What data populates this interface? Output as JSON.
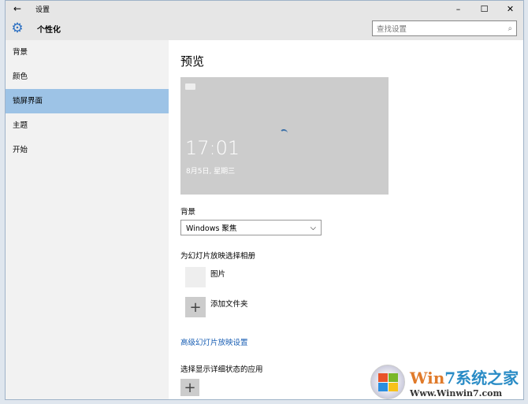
{
  "titlebar": {
    "title": "设置",
    "back": "←",
    "minimize": "–",
    "maximize": "☐",
    "close": "✕"
  },
  "header": {
    "title": "个性化",
    "search_placeholder": "查找设置",
    "search_icon": "⌕"
  },
  "sidebar": {
    "items": [
      {
        "label": "背景"
      },
      {
        "label": "颜色"
      },
      {
        "label": "锁屏界面",
        "selected": true
      },
      {
        "label": "主题"
      },
      {
        "label": "开始"
      }
    ]
  },
  "main": {
    "title": "预览",
    "preview": {
      "time": "17:01",
      "date": "8月5日, 星期三"
    },
    "background_label": "背景",
    "background_value": "Windows 聚焦",
    "chevron": "⌵",
    "album_label": "为幻灯片放映选择相册",
    "album_item": "图片",
    "add_folder": "添加文件夹",
    "plus": "+",
    "advanced_link": "高级幻灯片放映设置",
    "detail_app_label": "选择显示详细状态的应用"
  },
  "watermark": {
    "brand_w": "Win",
    "brand_7": "7",
    "brand_cn": "系统之家",
    "url": "Www.Winwin7.com"
  }
}
